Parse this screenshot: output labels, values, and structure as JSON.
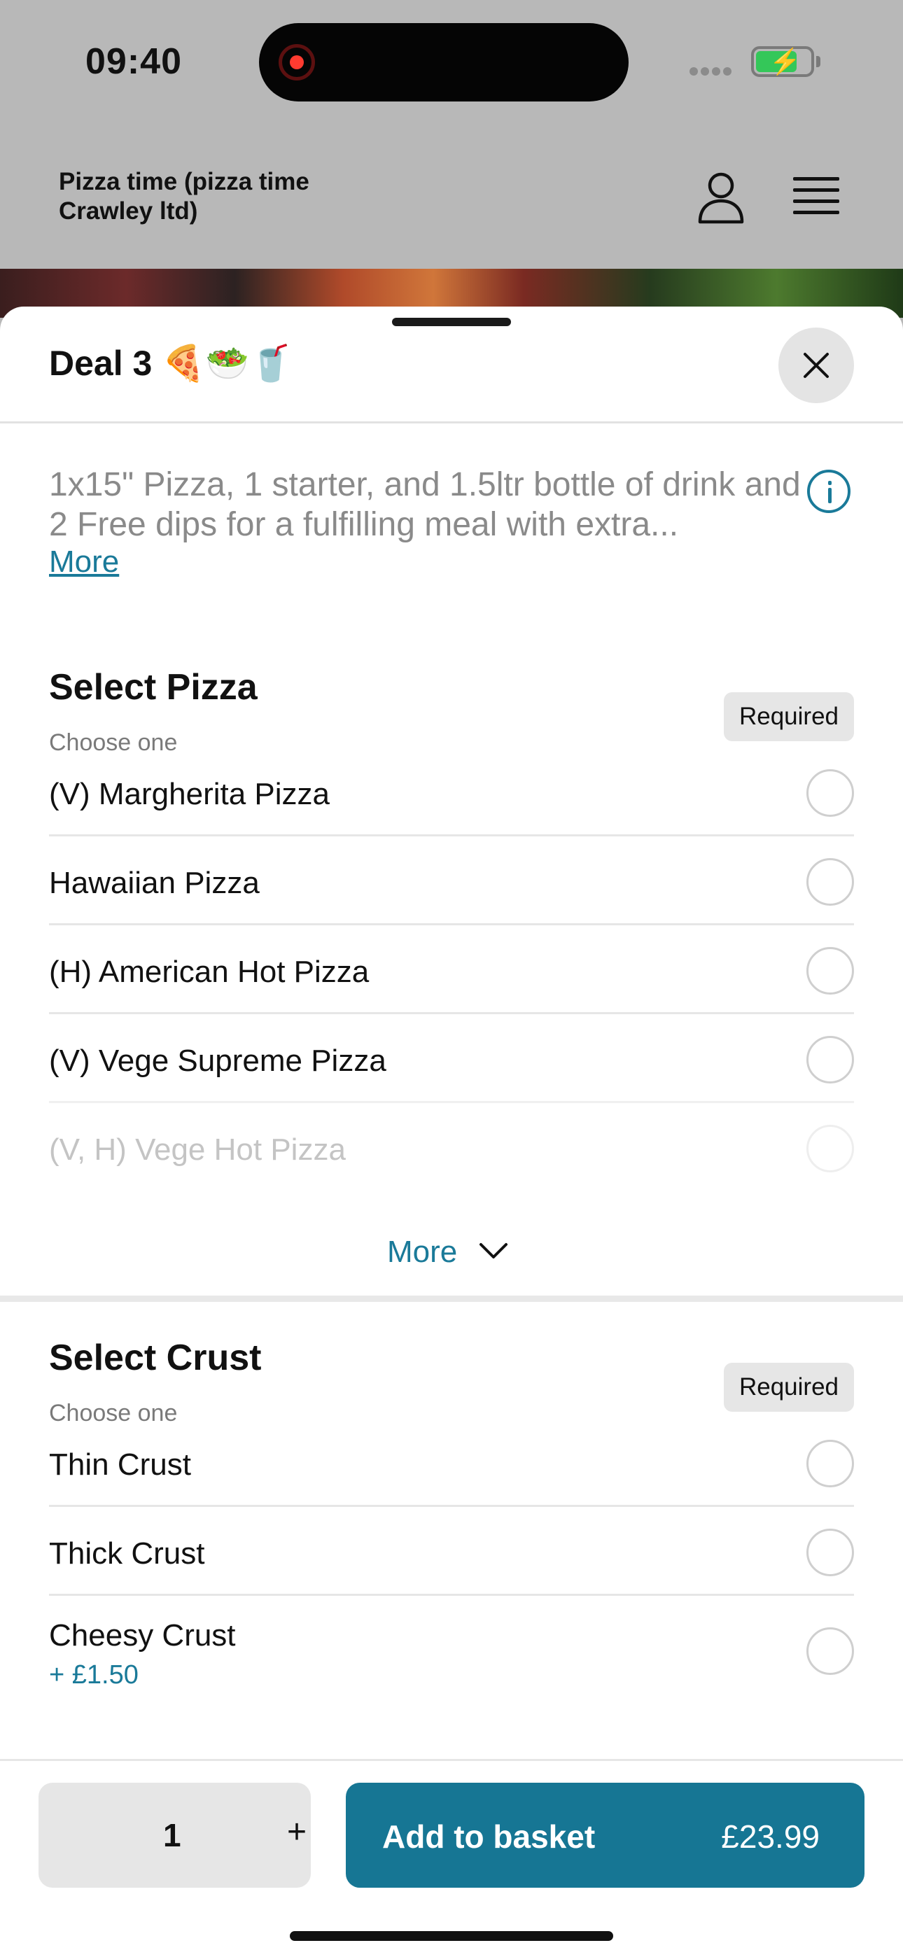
{
  "status_bar": {
    "time": "09:40"
  },
  "header": {
    "store_name": "Pizza time (pizza time Crawley ltd)",
    "account_icon": "user-icon",
    "menu_icon": "hamburger-menu-icon"
  },
  "sheet": {
    "title": "Deal 3 🍕🥗🥤",
    "description": "1x15\" Pizza, 1 starter, and 1.5ltr bottle of drink and 2 Free dips for a fulfilling meal with extra...",
    "more_link": "More",
    "close_icon": "close-icon",
    "info_icon": "info-icon"
  },
  "sections": [
    {
      "title": "Select Pizza",
      "subtitle": "Choose one",
      "badge": "Required",
      "options": [
        {
          "label": "(V) Margherita Pizza"
        },
        {
          "label": "Hawaiian Pizza"
        },
        {
          "label": "(H) American Hot Pizza"
        },
        {
          "label": "(V) Vege Supreme Pizza"
        },
        {
          "label": "(V, H) Vege Hot Pizza"
        }
      ],
      "more_toggle": "More"
    },
    {
      "title": "Select Crust",
      "subtitle": "Choose one",
      "badge": "Required",
      "options": [
        {
          "label": "Thin Crust"
        },
        {
          "label": "Thick Crust"
        },
        {
          "label": "Cheesy Crust",
          "price": "+ £1.50"
        }
      ]
    }
  ],
  "footer": {
    "quantity": "1",
    "plus": "+",
    "add_label": "Add to basket",
    "price": "£23.99"
  },
  "colors": {
    "accent": "#167694",
    "link": "#1a7a99",
    "required_badge": "#e6e6e6",
    "overlay": "#b8b8b8"
  }
}
